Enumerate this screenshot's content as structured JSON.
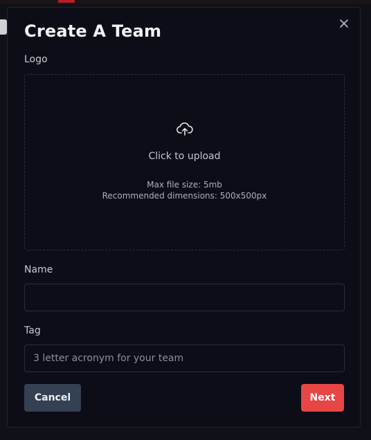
{
  "modal": {
    "title": "Create A Team",
    "close_icon": "close-icon"
  },
  "logo": {
    "label": "Logo",
    "upload_icon": "cloud-upload-icon",
    "upload_text": "Click to upload",
    "max_size": "Max file size: 5mb",
    "dimensions": "Recommended dimensions: 500x500px"
  },
  "name": {
    "label": "Name",
    "value": "",
    "placeholder": ""
  },
  "tag": {
    "label": "Tag",
    "value": "",
    "placeholder": "3 letter acronym for your team"
  },
  "actions": {
    "cancel_label": "Cancel",
    "next_label": "Next"
  },
  "colors": {
    "background": "#0c0d16",
    "cancel_button": "#344152",
    "next_button": "#e84545"
  }
}
